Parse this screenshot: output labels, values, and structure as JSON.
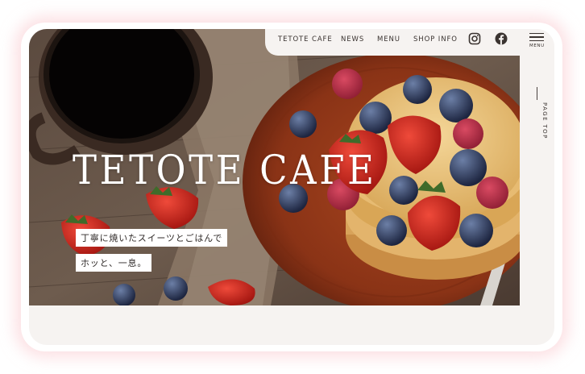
{
  "nav": {
    "items": [
      "TETOTE CAFE",
      "NEWS",
      "MENU",
      "SHOP INFO"
    ],
    "instagram_icon": "instagram-icon",
    "facebook_icon": "facebook-icon",
    "menu_label": "MENU"
  },
  "side": {
    "page_top_label": "PAGE TOP"
  },
  "hero": {
    "title": "TETOTE CAFE",
    "tagline_1": "丁寧に焼いたスイーツとごはんで",
    "tagline_2": "ホッと、一息。"
  },
  "colors": {
    "background": "#f6f3f1",
    "text": "#3a3330",
    "glow": "#fac8cd"
  }
}
